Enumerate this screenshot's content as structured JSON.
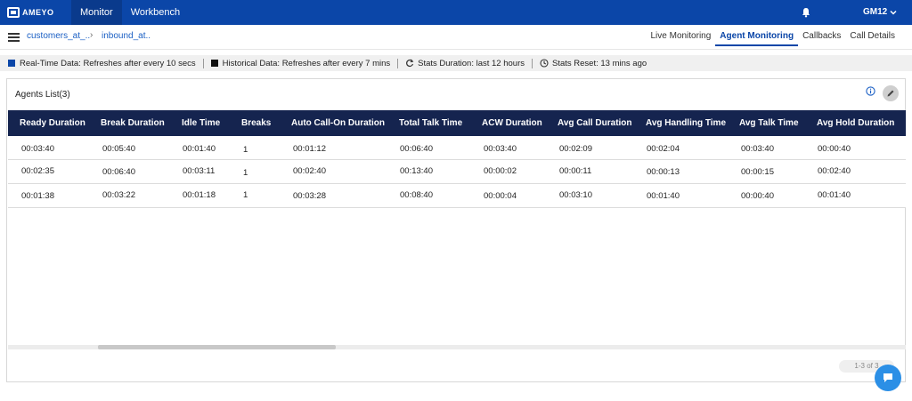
{
  "app": {
    "logo_text": "AMEYO"
  },
  "topnav": {
    "tabs": [
      {
        "label": "Monitor"
      },
      {
        "label": "Workbench"
      }
    ],
    "user": "GM12"
  },
  "breadcrumb": {
    "items": [
      "customers_at_..",
      "inbound_at.."
    ]
  },
  "view_tabs": [
    "Live Monitoring",
    "Agent Monitoring",
    "Callbacks",
    "Call Details"
  ],
  "stats": {
    "realtime": "Real-Time Data: Refreshes after every 10 secs",
    "historical": "Historical Data: Refreshes after every 7 mins",
    "duration": "Stats Duration: last 12 hours",
    "reset": "Stats Reset: 13 mins ago",
    "realtime_color": "#0b46a8",
    "historical_color": "#111111"
  },
  "panel": {
    "title": "Agents List(3)",
    "columns": [
      "Ready Duration",
      "Break Duration",
      "Idle Time",
      "Breaks",
      "Auto Call-On Duration",
      "Total Talk Time",
      "ACW Duration",
      "Avg Call Duration",
      "Avg Handling Time",
      "Avg Talk Time",
      "Avg Hold Duration"
    ],
    "rows": [
      [
        "00:03:40",
        "00:05:40",
        "00:01:40",
        "1",
        "00:01:12",
        "00:06:40",
        "00:03:40",
        "00:02:09",
        "00:02:04",
        "00:03:40",
        "00:00:40"
      ],
      [
        "00:02:35",
        "00:06:40",
        "00:03:11",
        "1",
        "00:02:40",
        "00:13:40",
        "00:00:02",
        "00:00:11",
        "00:00:13",
        "00:00:15",
        "00:02:40"
      ],
      [
        "00:01:38",
        "00:03:22",
        "00:01:18",
        "1",
        "00:03:28",
        "00:08:40",
        "00:00:04",
        "00:03:10",
        "00:01:40",
        "00:00:40",
        "00:01:40"
      ]
    ],
    "pager": "1-3 of 3"
  },
  "colors": {
    "topbar": "#0b46a8",
    "table_header": "#15244f",
    "accent": "#1a5fc4"
  }
}
